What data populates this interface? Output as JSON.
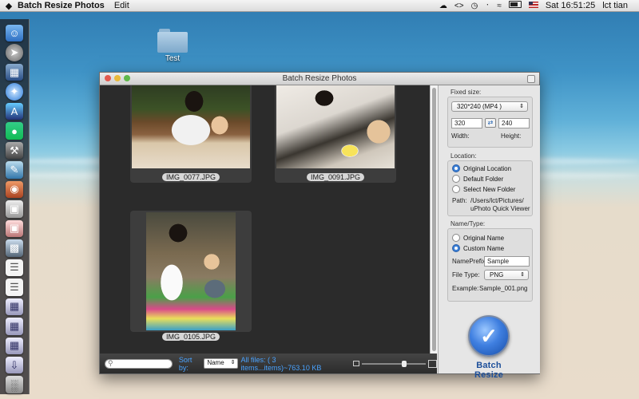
{
  "menubar": {
    "app_name": "Batch Resize Photos",
    "menus": [
      "Edit"
    ],
    "clock": "Sat 16:51:25",
    "user": "lct tian"
  },
  "desktop": {
    "folder_label": "Test"
  },
  "window": {
    "title": "Batch Resize Photos"
  },
  "gallery": {
    "items": [
      {
        "caption": "IMG_0077.JPG"
      },
      {
        "caption": "IMG_0091.JPG"
      },
      {
        "caption": "IMG_0105.JPG"
      }
    ]
  },
  "bottombar": {
    "search_placeholder": "",
    "sortby_label": "Sort by:",
    "sort_value": "Name",
    "all_files": "All files: ( 3 items...items)~763.10 KB"
  },
  "panel": {
    "fixed_size_title": "Fixed size:",
    "preset": "320*240 (MP4 )",
    "width_value": "320",
    "height_value": "240",
    "width_label": "Width:",
    "height_label": "Height:",
    "location_title": "Location:",
    "location_options": [
      "Original Location",
      "Default Folder",
      "Select New Folder"
    ],
    "path_label": "Path:",
    "path_value_line1": "/Users/lct/Pictures/",
    "path_value_line2": "uPhoto Quick Viewer",
    "name_type_title": "Name/Type:",
    "name_options": [
      "Original Name",
      "Custom Name"
    ],
    "nameprefix_label": "NamePrefix:",
    "nameprefix_value": "Sample",
    "filetype_label": "File Type:",
    "filetype_value": "PNG",
    "example_label": "Example:",
    "example_value": "Sample_001.png",
    "batch_resize_label": "Batch Resize"
  },
  "colors": {
    "accent": "#3b7fd6",
    "gallery_bg": "#2b2b2b"
  }
}
